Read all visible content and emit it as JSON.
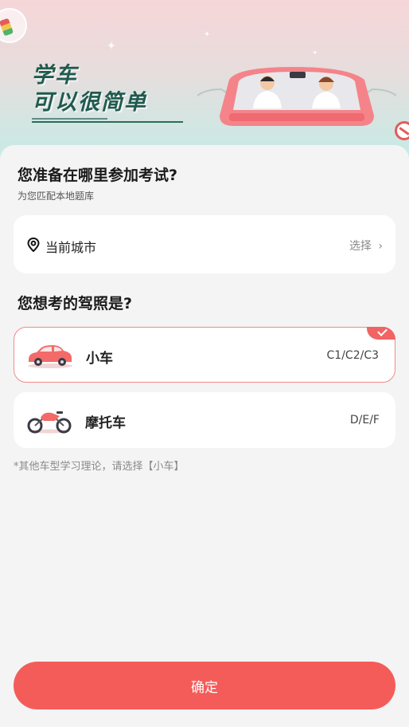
{
  "banner": {
    "title_line1": "学车",
    "title_line2": "可以很简单"
  },
  "location": {
    "heading": "您准备在哪里参加考试?",
    "subheading": "为您匹配本地题库",
    "city_label": "当前城市",
    "choose_label": "选择",
    "choose_icon": "chevron-right-icon",
    "pin_icon": "location-pin-icon"
  },
  "license": {
    "heading": "您想考的驾照是?",
    "options": [
      {
        "name": "小车",
        "codes": "C1/C2/C3",
        "icon": "car-icon",
        "selected": true
      },
      {
        "name": "摩托车",
        "codes": "D/E/F",
        "icon": "motorcycle-icon",
        "selected": false
      }
    ],
    "note": "*其他车型学习理论，请选择【小车】"
  },
  "actions": {
    "confirm_label": "确定"
  },
  "colors": {
    "accent": "#f45c5a",
    "selected_border": "#f08a8a",
    "banner_title": "#1f5a4e"
  }
}
